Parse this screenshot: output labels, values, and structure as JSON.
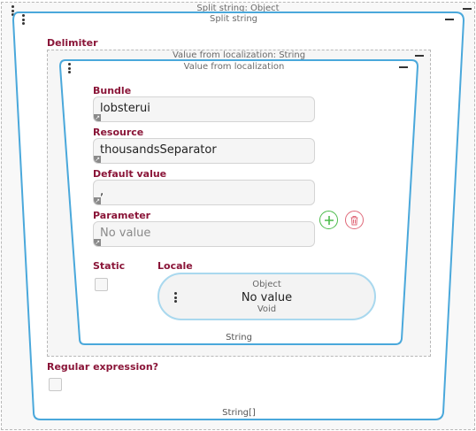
{
  "outer": {
    "title": "Split string: Object"
  },
  "split_block": {
    "title": "Split string",
    "delimiter_label": "Delimiter",
    "regex_label": "Regular expression?",
    "footer_type": "String[]"
  },
  "value_frame": {
    "title": "Value from localization: String"
  },
  "value_block": {
    "title": "Value from localization",
    "footer_type": "String",
    "bundle": {
      "label": "Bundle",
      "value": "lobsterui"
    },
    "resource": {
      "label": "Resource",
      "value": "thousandsSeparator"
    },
    "default_value": {
      "label": "Default value",
      "value": ","
    },
    "parameter": {
      "label": "Parameter",
      "value": "No value"
    },
    "static_label": "Static",
    "locale": {
      "label": "Locale",
      "type_top": "Object",
      "value": "No value",
      "type_bottom": "Void"
    }
  },
  "colors": {
    "accent_border": "#4aa8db",
    "label": "#8a1538",
    "add_green": "#4cbb4c",
    "delete_red": "#e06a7a"
  },
  "icons": {
    "add": "plus-circle-icon",
    "delete": "trash-icon",
    "drag": "kebab-icon",
    "collapse": "minimize-icon",
    "link": "arrow-corner-icon"
  }
}
